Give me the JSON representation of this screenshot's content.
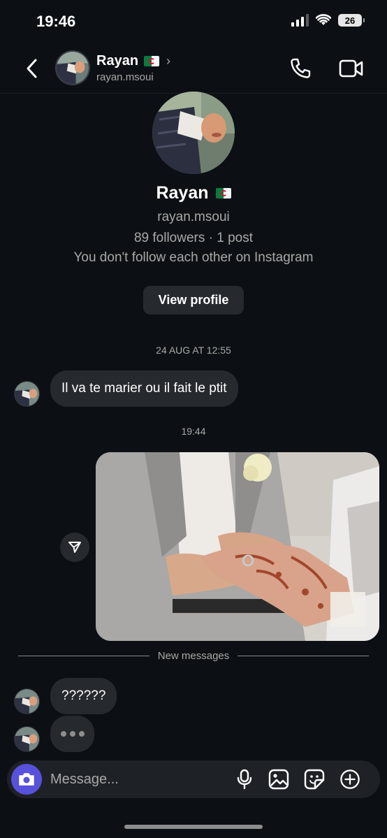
{
  "status_bar": {
    "time": "19:46",
    "battery": "26"
  },
  "header": {
    "name": "Rayan",
    "username": "rayan.msoui",
    "icons": [
      "back-icon",
      "phone-icon",
      "video-call-icon"
    ]
  },
  "profile": {
    "name": "Rayan",
    "username": "rayan.msoui",
    "stats": "89 followers · 1 post",
    "follow_note": "You don't follow each other on Instagram",
    "view_profile_label": "View profile"
  },
  "conversation": {
    "timestamp_1": "24 AUG AT 12:55",
    "message_1": "Il va te marier ou il fait le ptit",
    "timestamp_2": "19:44",
    "new_messages_label": "New messages",
    "message_2": "??????"
  },
  "composer": {
    "placeholder": "Message...",
    "accent": "#5851db"
  },
  "colors": {
    "background": "#0c1014",
    "bubble": "#262a2f",
    "secondary_text": "#a8a8a8"
  }
}
